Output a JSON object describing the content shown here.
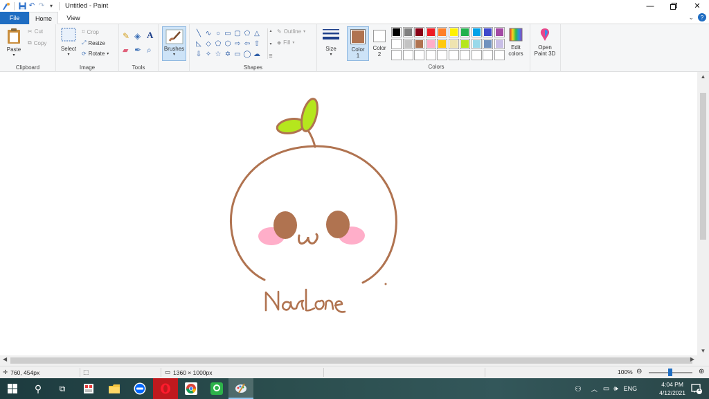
{
  "window": {
    "title": "Untitled - Paint"
  },
  "tabs": {
    "file": "File",
    "home": "Home",
    "view": "View"
  },
  "ribbon": {
    "clipboard": {
      "label": "Clipboard",
      "paste": "Paste",
      "cut": "Cut",
      "copy": "Copy"
    },
    "image": {
      "label": "Image",
      "select": "Select",
      "crop": "Crop",
      "resize": "Resize",
      "rotate": "Rotate"
    },
    "tools": {
      "label": "Tools"
    },
    "brushes": "Brushes",
    "shapes": {
      "label": "Shapes",
      "outline": "Outline",
      "fill": "Fill"
    },
    "size": "Size",
    "color1": "Color\n1",
    "color2": "Color\n2",
    "colors": {
      "label": "Colors",
      "edit": "Edit\ncolors",
      "open3d": "Open\nPaint 3D"
    }
  },
  "palette": {
    "color1": "#b07350",
    "color2": "#ffffff",
    "swatches": [
      "#000000",
      "#7f7f7f",
      "#880015",
      "#ed1c24",
      "#ff7f27",
      "#fff200",
      "#22b14c",
      "#00a2e8",
      "#3f48cc",
      "#a349a4",
      "#ffffff",
      "#c3c3c3",
      "#b07350",
      "#ffaec9",
      "#ffc90e",
      "#efe4b0",
      "#b5e61d",
      "#99d9ea",
      "#7092be",
      "#c8bfe7",
      "#ffffff",
      "#ffffff",
      "#ffffff",
      "#ffffff",
      "#ffffff",
      "#ffffff",
      "#ffffff",
      "#ffffff",
      "#ffffff",
      "#ffffff"
    ]
  },
  "drawing": {
    "signature": "Narlona",
    "face": "ω",
    "stroke_color": "#b07350",
    "leaf_color": "#b5e61d",
    "blush_color": "#ffaec9"
  },
  "status": {
    "cursor_pos": "760, 454px",
    "canvas_size": "1360 × 1000px",
    "zoom": "100%"
  },
  "taskbar": {
    "language": "ENG",
    "time": "4:04 PM",
    "date": "4/12/2021",
    "notification_count": "1"
  }
}
